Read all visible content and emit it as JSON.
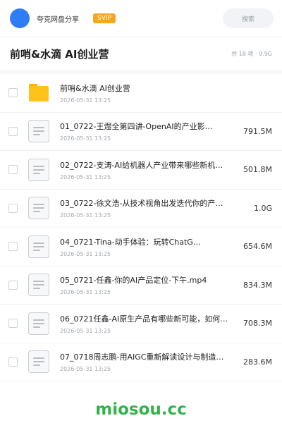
{
  "header": {
    "share_name": "夸克网盘分享",
    "badge": "SVIP",
    "search_label": "搜索"
  },
  "folder": {
    "title": "前哨&水滴 AI创业营",
    "summary": "共 18 项 · 9.9G"
  },
  "files": [
    {
      "name": "前哨&水滴 AI创业营",
      "date": "2026-05-31 13:25",
      "size": "",
      "kind": "folder"
    },
    {
      "name": "01_0722-王煜全第四讲-OpenAI的产业影…",
      "date": "2026-05-31 13:25",
      "size": "791.5M",
      "kind": "doc"
    },
    {
      "name": "02_0722-支涛-AI给机器人产业带来哪些新机…",
      "date": "2026-05-31 13:25",
      "size": "501.8M",
      "kind": "doc"
    },
    {
      "name": "03_0722-徐文浩-从技术视角出发迭代你的产品…",
      "date": "2026-05-31 13:25",
      "size": "1.0G",
      "kind": "doc"
    },
    {
      "name": "04_0721-Tina-动手体验：玩转ChatG…",
      "date": "2026-05-31 13:25",
      "size": "654.6M",
      "kind": "doc"
    },
    {
      "name": "05_0721-任鑫-你的AI产品定位-下午.mp4",
      "date": "2026-05-31 13:25",
      "size": "834.3M",
      "kind": "doc"
    },
    {
      "name": "06_0721任鑫-AI原生产品有哪些新可能，如何…",
      "date": "2026-05-31 13:25",
      "size": "708.3M",
      "kind": "doc"
    },
    {
      "name": "07_0718周志鹏-用AIGC重新解读设计与制造…",
      "date": "2026-05-31 13:25",
      "size": "283.6M",
      "kind": "doc"
    }
  ],
  "watermark": "miosou.cc",
  "colors": {
    "accent": "#2e7cf6",
    "svip": "#f6a623",
    "folder": "#ffc21a",
    "watermark": "#32b24a"
  }
}
